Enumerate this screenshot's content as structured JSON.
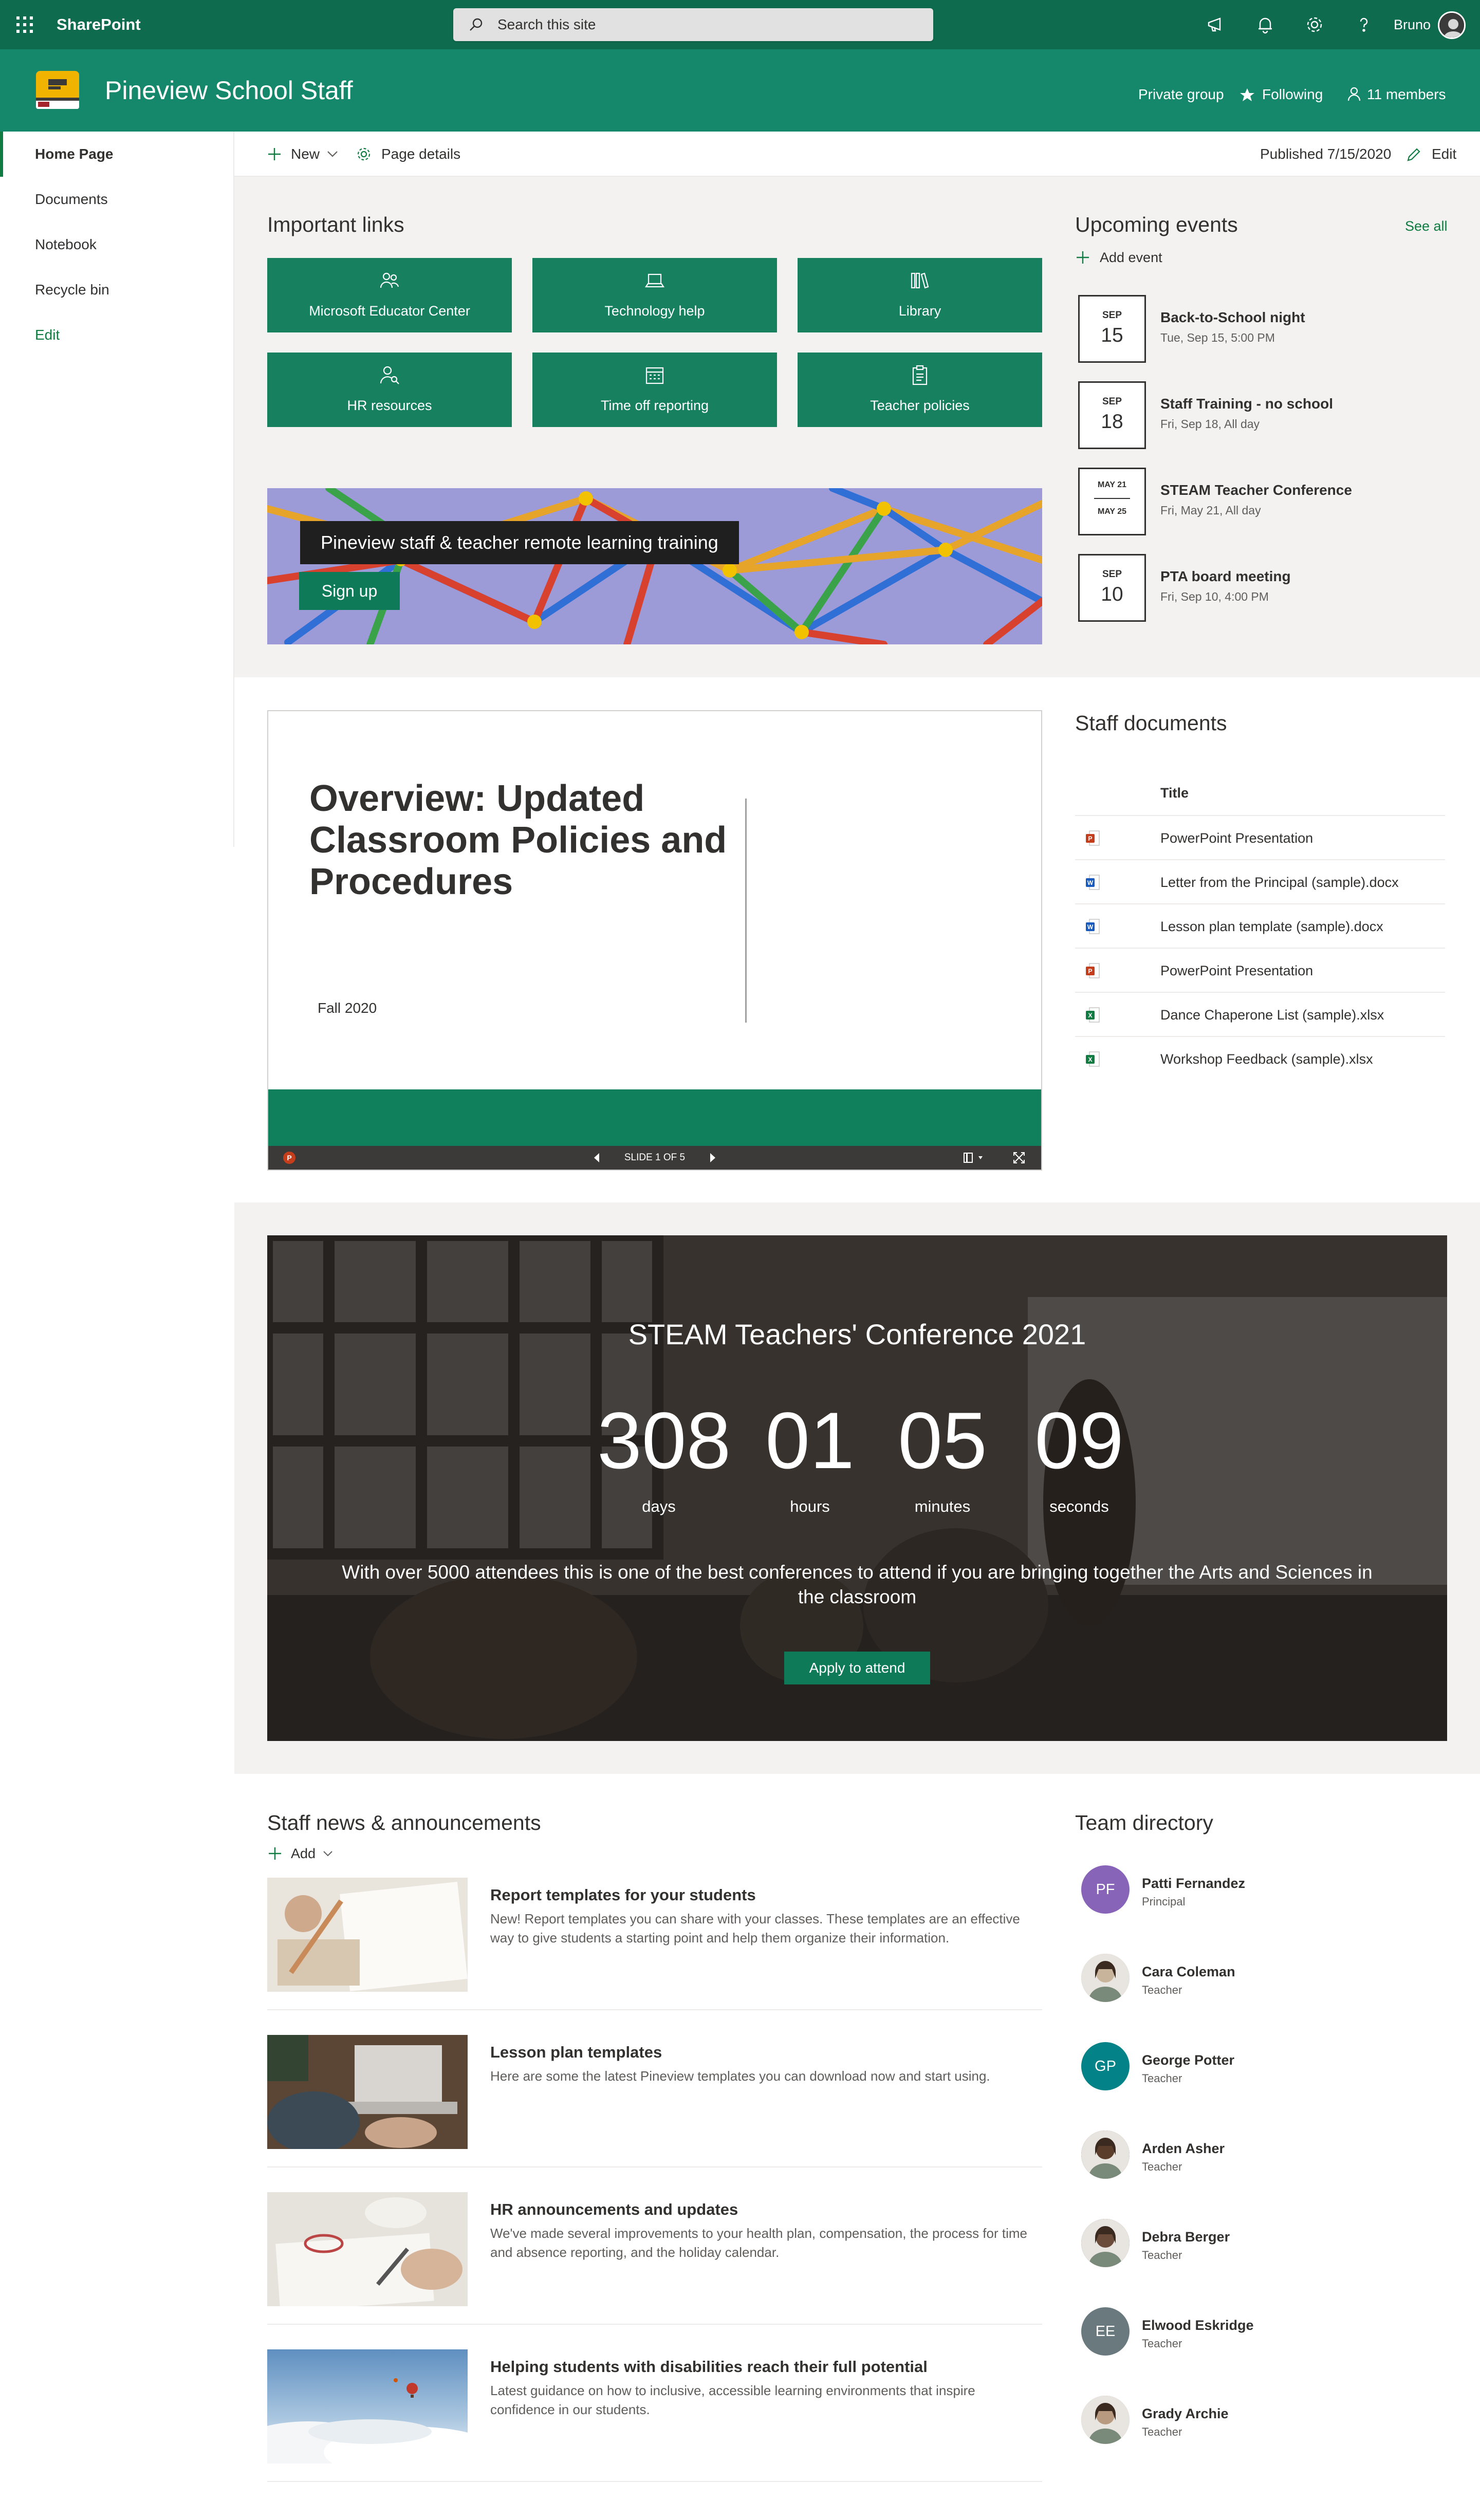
{
  "suite": {
    "app_name": "SharePoint",
    "search_placeholder": "Search this site",
    "user_name": "Bruno"
  },
  "site": {
    "title": "Pineview School Staff",
    "privacy": "Private group",
    "following": "Following",
    "members": "11 members"
  },
  "nav": {
    "items": [
      {
        "label": "Home Page",
        "active": true
      },
      {
        "label": "Documents"
      },
      {
        "label": "Notebook"
      },
      {
        "label": "Recycle bin"
      },
      {
        "label": "Edit"
      }
    ]
  },
  "command_bar": {
    "new_label": "New",
    "page_details_label": "Page details",
    "published": "Published 7/15/2020",
    "edit_label": "Edit"
  },
  "important_links": {
    "title": "Important links",
    "items": [
      {
        "label": "Microsoft Educator Center",
        "icon": "people-icon"
      },
      {
        "label": "Technology help",
        "icon": "laptop-icon"
      },
      {
        "label": "Library",
        "icon": "books-icon"
      },
      {
        "label": "HR resources",
        "icon": "person-search-icon"
      },
      {
        "label": "Time off reporting",
        "icon": "calendar-icon"
      },
      {
        "label": "Teacher policies",
        "icon": "clipboard-icon"
      }
    ]
  },
  "banner": {
    "title": "Pineview staff & teacher remote learning training",
    "button": "Sign up"
  },
  "events": {
    "title": "Upcoming events",
    "see_all": "See all",
    "add_event": "Add event",
    "items": [
      {
        "month": "SEP",
        "day": "15",
        "title": "Back-to-School night",
        "when": "Tue, Sep 15, 5:00 PM"
      },
      {
        "month": "SEP",
        "day": "18",
        "title": "Staff Training - no school",
        "when": "Fri, Sep 18, All day"
      },
      {
        "start": "MAY 21",
        "end": "MAY 25",
        "title": "STEAM Teacher Conference",
        "when": "Fri, May 21, All day"
      },
      {
        "month": "SEP",
        "day": "10",
        "title": "PTA board meeting",
        "when": "Fri, Sep 10, 4:00 PM"
      }
    ]
  },
  "slide": {
    "title": "Overview: Updated Classroom Policies and Procedures",
    "subtitle": "Fall 2020",
    "counter": "SLIDE 1 OF 5"
  },
  "staff_documents": {
    "title": "Staff documents",
    "column": "Title",
    "items": [
      {
        "name": "PowerPoint Presentation",
        "type": "ppt",
        "color": "#c43e1c"
      },
      {
        "name": "Letter from the Principal (sample).docx",
        "type": "doc",
        "color": "#185abd"
      },
      {
        "name": "Lesson plan template (sample).docx",
        "type": "doc",
        "color": "#185abd"
      },
      {
        "name": "PowerPoint Presentation",
        "type": "ppt",
        "color": "#c43e1c"
      },
      {
        "name": "Dance Chaperone List (sample).xlsx",
        "type": "xls",
        "color": "#107c41"
      },
      {
        "name": "Workshop Feedback (sample).xlsx",
        "type": "xls",
        "color": "#107c41"
      }
    ]
  },
  "countdown": {
    "title": "STEAM Teachers' Conference 2021",
    "units": [
      {
        "value": "308",
        "label": "days"
      },
      {
        "value": "01",
        "label": "hours"
      },
      {
        "value": "05",
        "label": "minutes"
      },
      {
        "value": "09",
        "label": "seconds"
      }
    ],
    "description": "With over 5000 attendees this is one of the best conferences to attend if you are bringing together the Arts and Sciences in the classroom",
    "button": "Apply to attend"
  },
  "news": {
    "title": "Staff news & announcements",
    "add_label": "Add",
    "items": [
      {
        "title": "Report templates for your students",
        "desc": "New! Report templates you can share with your classes. These templates are an effective way to give students a starting point and help them organize their information."
      },
      {
        "title": "Lesson plan templates",
        "desc": "Here are some the latest Pineview templates you can download now and start using."
      },
      {
        "title": "HR announcements and updates",
        "desc": "We've made several improvements to your health plan, compensation, the process for time and absence reporting, and the holiday calendar."
      },
      {
        "title": "Helping students with disabilities reach their full potential",
        "desc": "Latest guidance on how to inclusive, accessible learning environments that inspire confidence in our students."
      }
    ]
  },
  "directory": {
    "title": "Team directory",
    "people": [
      {
        "name": "Patti Fernandez",
        "role": "Principal",
        "initials": "PF",
        "color": "#8764b8"
      },
      {
        "name": "Cara Coleman",
        "role": "Teacher",
        "initials": "",
        "color": "#c8b49a"
      },
      {
        "name": "George Potter",
        "role": "Teacher",
        "initials": "GP",
        "color": "#038387"
      },
      {
        "name": "Arden Asher",
        "role": "Teacher",
        "initials": "",
        "color": "#5a3e2b"
      },
      {
        "name": "Debra Berger",
        "role": "Teacher",
        "initials": "",
        "color": "#6b4c3b"
      },
      {
        "name": "Elwood Eskridge",
        "role": "Teacher",
        "initials": "EE",
        "color": "#69797e"
      },
      {
        "name": "Grady Archie",
        "role": "Teacher",
        "initials": "",
        "color": "#b89a80"
      }
    ]
  }
}
